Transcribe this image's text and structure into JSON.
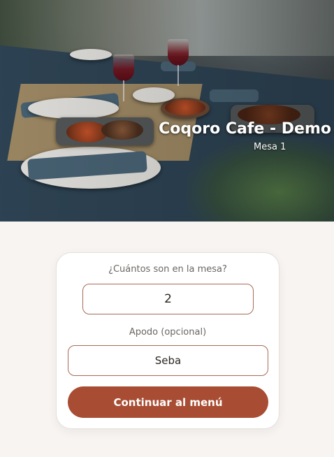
{
  "header": {
    "restaurant_name": "Coqoro Cafe - Demo",
    "table_label": "Mesa 1"
  },
  "form": {
    "guests_label": "¿Cuántos son en la mesa?",
    "guests_value": "2",
    "nickname_label": "Apodo (opcional)",
    "nickname_value": "Seba",
    "continue_label": "Continuar al menú"
  },
  "colors": {
    "accent": "#a84d33",
    "background": "#f8f4f1"
  }
}
